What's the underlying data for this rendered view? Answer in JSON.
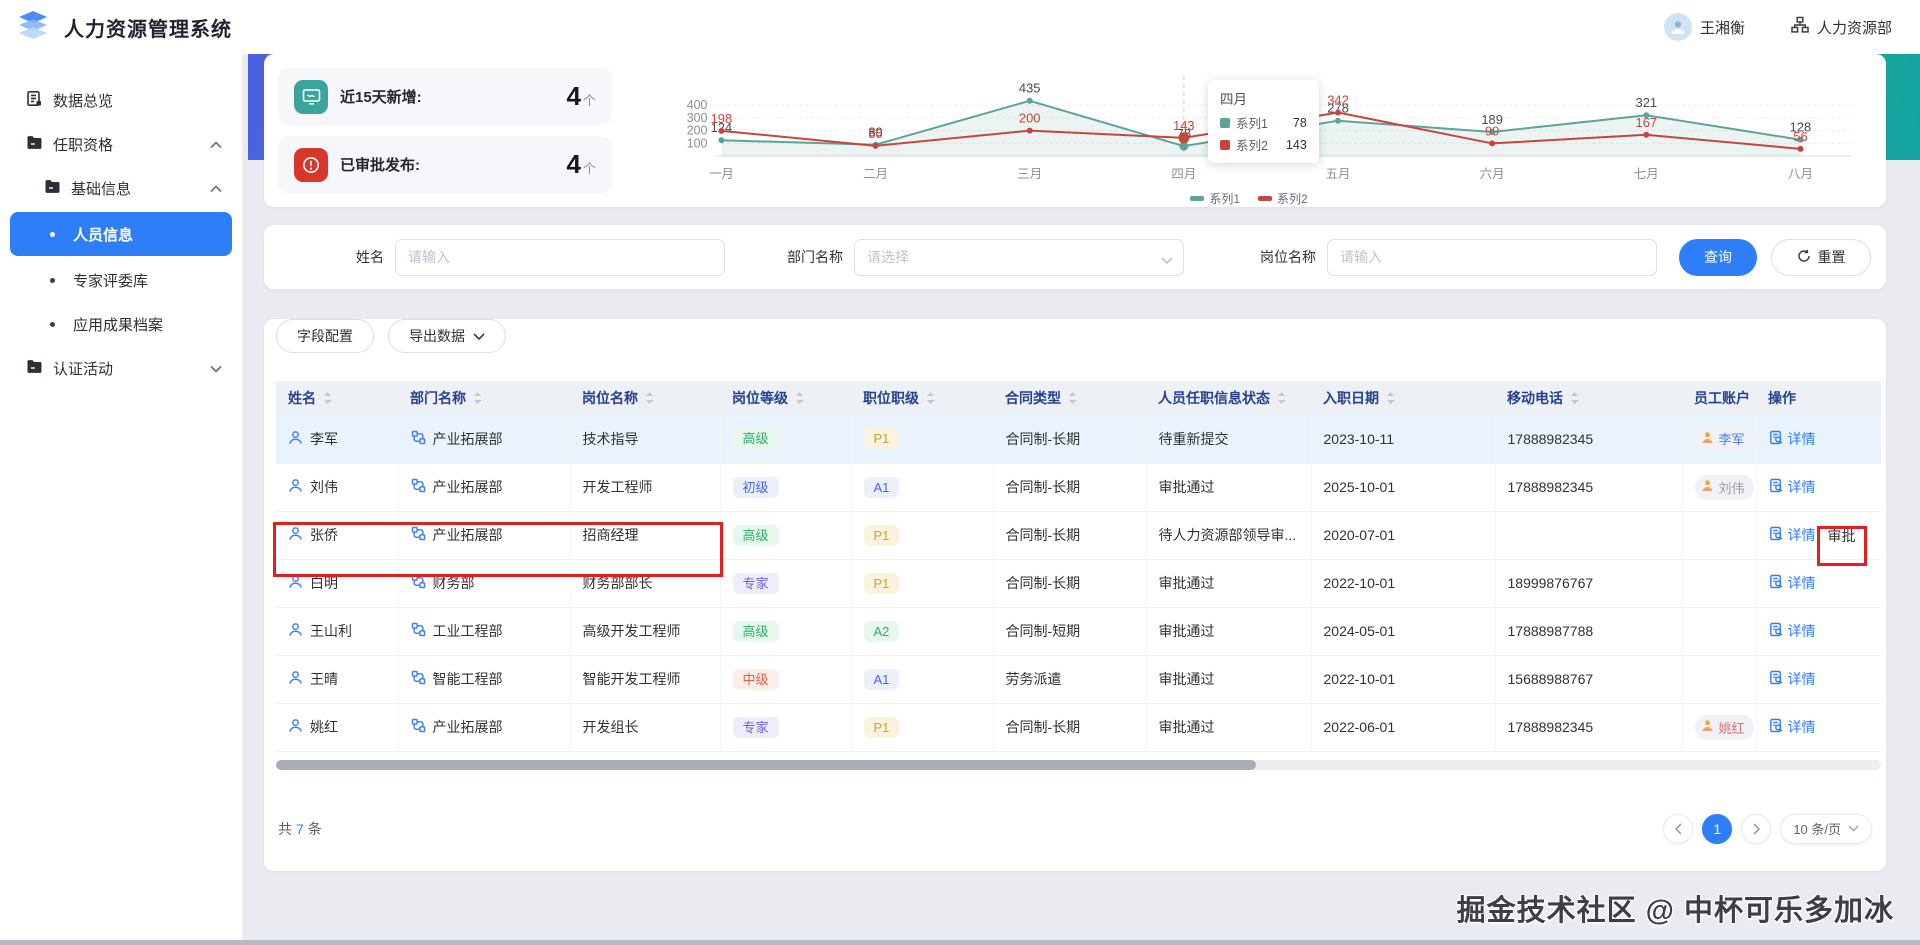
{
  "app": {
    "title": "人力资源管理系统"
  },
  "header": {
    "user": "王湘衡",
    "department": "人力资源部"
  },
  "sidebar": {
    "items": [
      {
        "label": "数据总览",
        "icon": "dashboard-icon",
        "level": 0
      },
      {
        "label": "任职资格",
        "icon": "folder-icon",
        "level": 0,
        "expand": "up"
      },
      {
        "label": "基础信息",
        "icon": "folder-icon",
        "level": 1,
        "expand": "up"
      },
      {
        "label": "人员信息",
        "level": 2,
        "bullet": true,
        "active": true
      },
      {
        "label": "专家评委库",
        "level": 2,
        "bullet": true
      },
      {
        "label": "应用成果档案",
        "level": 2,
        "bullet": true
      },
      {
        "label": "认证活动",
        "icon": "folder-icon",
        "level": 0,
        "expand": "down"
      }
    ]
  },
  "breadcrumb": [
    "任职资格",
    "基础信息",
    "人员信息"
  ],
  "stats": [
    {
      "icon": "monitor-icon",
      "icon_bg": "#3aa69b",
      "label": "近15天新增:",
      "value": "4",
      "unit": "个"
    },
    {
      "icon": "alert-icon",
      "icon_bg": "#d8352c",
      "label": "已审批发布:",
      "value": "4",
      "unit": "个"
    }
  ],
  "chart_data": {
    "type": "line",
    "categories": [
      "一月",
      "二月",
      "三月",
      "四月",
      "五月",
      "六月",
      "七月",
      "八月"
    ],
    "series": [
      {
        "name": "系列1",
        "color": "#5ca498",
        "values": [
          124,
          89,
          435,
          78,
          278,
          189,
          321,
          128
        ]
      },
      {
        "name": "系列2",
        "color": "#c8453e",
        "values": [
          198,
          80,
          200,
          143,
          342,
          99,
          167,
          56
        ]
      }
    ],
    "ylim": [
      0,
      450
    ],
    "yticks": [
      100,
      200,
      300,
      400
    ],
    "grid": true,
    "legend_position": "bottom",
    "tooltip": {
      "title": "四月",
      "highlight_index": 3,
      "entries": [
        {
          "name": "系列1",
          "color": "#5ca498",
          "value": "78"
        },
        {
          "name": "系列2",
          "color": "#c8453e",
          "value": "143"
        }
      ]
    }
  },
  "filters": {
    "name_label": "姓名",
    "name_placeholder": "请输入",
    "dept_label": "部门名称",
    "dept_placeholder": "请选择",
    "post_label": "岗位名称",
    "post_placeholder": "请输入",
    "search_label": "查询",
    "reset_label": "重置"
  },
  "toolbar": {
    "field_config": "字段配置",
    "export": "导出数据"
  },
  "table": {
    "columns": [
      {
        "label": "姓名",
        "sortable": true
      },
      {
        "label": "部门名称",
        "sortable": true
      },
      {
        "label": "岗位名称",
        "sortable": true
      },
      {
        "label": "岗位等级",
        "sortable": true
      },
      {
        "label": "职位职级",
        "sortable": true
      },
      {
        "label": "合同类型",
        "sortable": true
      },
      {
        "label": "人员任职信息状态",
        "sortable": true
      },
      {
        "label": "入职日期",
        "sortable": true
      },
      {
        "label": "移动电话",
        "sortable": true
      },
      {
        "label": "员工账户",
        "sortable": false
      },
      {
        "label": "操作",
        "sortable": false
      }
    ],
    "rows": [
      {
        "name": "李军",
        "dept": "产业拓展部",
        "post": "技术指导",
        "grade": {
          "text": "高级",
          "color": "green"
        },
        "rank": {
          "text": "P1",
          "color": "gold"
        },
        "contract": "合同制-长期",
        "status": "待重新提交",
        "hire_date": "2023-10-11",
        "phone": "17888982345",
        "account": {
          "text": "李军",
          "color": "#4a7df0"
        },
        "actions": [
          "详情"
        ],
        "hover": true
      },
      {
        "name": "刘伟",
        "dept": "产业拓展部",
        "post": "开发工程师",
        "grade": {
          "text": "初级",
          "color": "blue"
        },
        "rank": {
          "text": "A1",
          "color": "blue"
        },
        "contract": "合同制-长期",
        "status": "审批通过",
        "hire_date": "2025-10-01",
        "phone": "17888982345",
        "account": {
          "text": "刘伟",
          "color": "#9b9c9e"
        },
        "actions": [
          "详情"
        ]
      },
      {
        "name": "张侨",
        "dept": "产业拓展部",
        "post": "招商经理",
        "grade": {
          "text": "高级",
          "color": "green"
        },
        "rank": {
          "text": "P1",
          "color": "gold"
        },
        "contract": "合同制-长期",
        "status": "待人力资源部领导审...",
        "hire_date": "2020-07-01",
        "phone": "",
        "account": null,
        "actions": [
          "详情",
          "审批"
        ]
      },
      {
        "name": "白明",
        "dept": "财务部",
        "post": "财务部部长",
        "grade": {
          "text": "专家",
          "color": "purple"
        },
        "rank": {
          "text": "P1",
          "color": "gold"
        },
        "contract": "合同制-长期",
        "status": "审批通过",
        "hire_date": "2022-10-01",
        "phone": "18999876767",
        "account": null,
        "actions": [
          "详情"
        ]
      },
      {
        "name": "王山利",
        "dept": "工业工程部",
        "post": "高级开发工程师",
        "grade": {
          "text": "高级",
          "color": "green"
        },
        "rank": {
          "text": "A2",
          "color": "green"
        },
        "contract": "合同制-短期",
        "status": "审批通过",
        "hire_date": "2024-05-01",
        "phone": "17888987788",
        "account": null,
        "actions": [
          "详情"
        ]
      },
      {
        "name": "王晴",
        "dept": "智能工程部",
        "post": "智能开发工程师",
        "grade": {
          "text": "中级",
          "color": "orange"
        },
        "rank": {
          "text": "A1",
          "color": "blue"
        },
        "contract": "劳务派遣",
        "status": "审批通过",
        "hire_date": "2022-10-01",
        "phone": "15688988767",
        "account": null,
        "actions": [
          "详情"
        ]
      },
      {
        "name": "姚红",
        "dept": "产业拓展部",
        "post": "开发组长",
        "grade": {
          "text": "专家",
          "color": "purple"
        },
        "rank": {
          "text": "P1",
          "color": "gold"
        },
        "contract": "合同制-长期",
        "status": "审批通过",
        "hire_date": "2022-06-01",
        "phone": "17888982345",
        "account": {
          "text": "姚红",
          "color": "#e06c75"
        },
        "actions": [
          "详情"
        ]
      }
    ]
  },
  "footer": {
    "total_prefix": "共",
    "total_count": "7",
    "total_suffix": "条",
    "pagination": {
      "current_page": "1",
      "page_size": "10 条/页"
    }
  },
  "watermark": "掘金技术社区 @ 中杯可乐多加冰",
  "colors": {
    "accent": "#2e7ef7",
    "series1": "#5ca498",
    "series2": "#c8453e",
    "annotation": "#e01f1f"
  }
}
